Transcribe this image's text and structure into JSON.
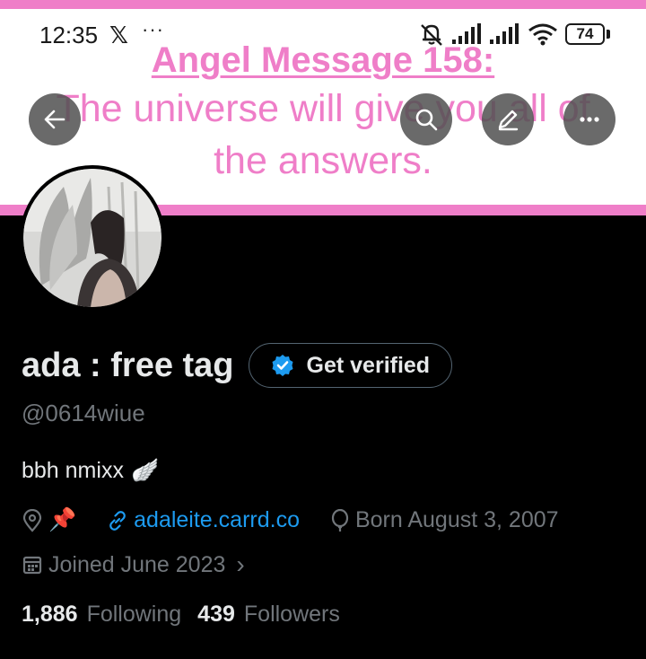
{
  "status_bar": {
    "time": "12:35",
    "app_icon": "x-logo",
    "more": "···",
    "battery": "74"
  },
  "banner": {
    "title": "Angel Message 158:",
    "line1": "The universe will give you all of",
    "line2": "the answers.",
    "color": "#ef7ec8"
  },
  "header": {
    "back_icon": "arrow-left-icon",
    "search_icon": "search-icon",
    "edit_icon": "pencil-icon",
    "more_icon": "more-icon"
  },
  "profile": {
    "display_name": "ada : free tag",
    "verify_button": "Get verified",
    "handle": "@0614wiue",
    "bio_text": "bbh nmixx",
    "bio_emoji": "🪽",
    "location_emoji": "📌",
    "website": "adaleite.carrd.co",
    "birthday": "Born August 3, 2007",
    "joined": "Joined June 2023",
    "joined_chevron": "›",
    "following_count": "1,886",
    "following_label": "Following",
    "followers_count": "439",
    "followers_label": "Followers"
  },
  "colors": {
    "background": "#000000",
    "accent": "#1d9bf0",
    "muted": "#71767b",
    "text": "#e7e9ea"
  }
}
